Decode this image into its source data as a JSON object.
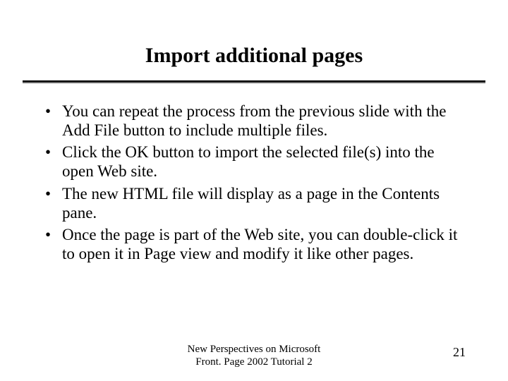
{
  "title": "Import additional pages",
  "bullets": [
    "You can repeat the process from the previous slide with the Add File button to include multiple files.",
    "Click the OK button to import the selected file(s) into the open Web site.",
    "The new HTML file will display as a page in the Contents pane.",
    "Once the page is part of the Web site, you can double-click it to open it in Page view and modify it like other pages."
  ],
  "footer": {
    "line1": "New Perspectives on Microsoft",
    "line2": "Front. Page 2002 Tutorial 2"
  },
  "page_number": "21"
}
